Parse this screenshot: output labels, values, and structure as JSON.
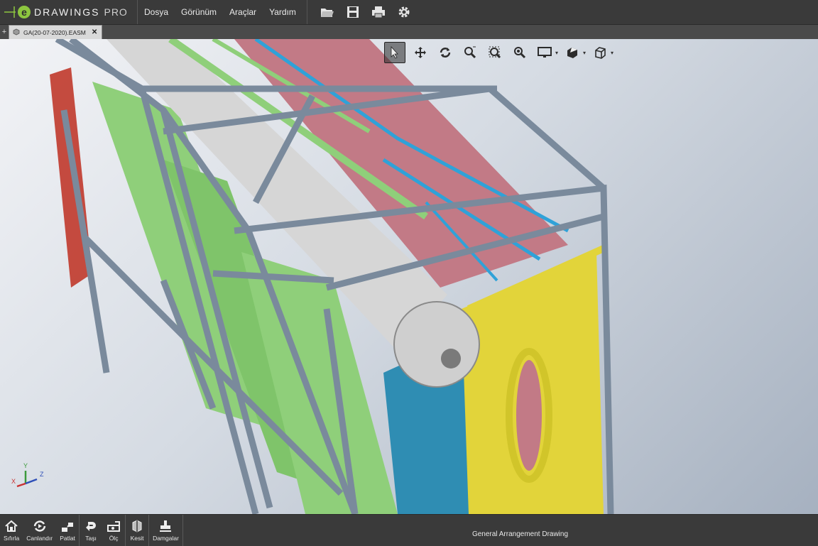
{
  "app": {
    "brand": "DRAWINGS",
    "edition": "PRO",
    "logo_letter": "e"
  },
  "menu": [
    {
      "label": "Dosya"
    },
    {
      "label": "Görünüm"
    },
    {
      "label": "Araçlar"
    },
    {
      "label": "Yardım"
    }
  ],
  "toolbar_icons": [
    "open-folder-icon",
    "save-icon",
    "print-icon",
    "gear-icon"
  ],
  "tabs": [
    {
      "label": "GA(20-07-2020).EASM",
      "active": true
    }
  ],
  "view_toolbar": [
    "select-icon",
    "pan-icon",
    "rotate-icon",
    "zoom-window-icon",
    "zoom-fit-icon",
    "zoom-icon",
    "display-mode-icon",
    "section-view-icon",
    "standard-views-icon"
  ],
  "triad": {
    "x": "X",
    "y": "Y",
    "z": "Z"
  },
  "bottom_buttons": [
    {
      "label": "Sıfırla",
      "icon": "home-icon",
      "group": 1
    },
    {
      "label": "Canlandır",
      "icon": "animate-icon",
      "group": 1
    },
    {
      "label": "Patlat",
      "icon": "explode-icon",
      "group": 1
    },
    {
      "label": "Taşı",
      "icon": "move-icon",
      "group": 2
    },
    {
      "label": "Ölç",
      "icon": "measure-icon",
      "group": 2
    },
    {
      "label": "Kesit",
      "icon": "section-icon",
      "group": 3
    },
    {
      "label": "Damgalar",
      "icon": "stamp-icon",
      "group": 4
    }
  ],
  "status": "General Arrangement Drawing",
  "colors": {
    "frame_steel": "#7a8a9c",
    "boiler_drum": "#cfcfcf",
    "tube_pink": "#c27a86",
    "tube_green": "#8fcf7a",
    "pipe_blue": "#2fa2d8",
    "panel_yellow": "#e2d43a",
    "panel_blue": "#2f8db3",
    "panel_red": "#c0392b",
    "accent_green": "#8dc63f"
  }
}
